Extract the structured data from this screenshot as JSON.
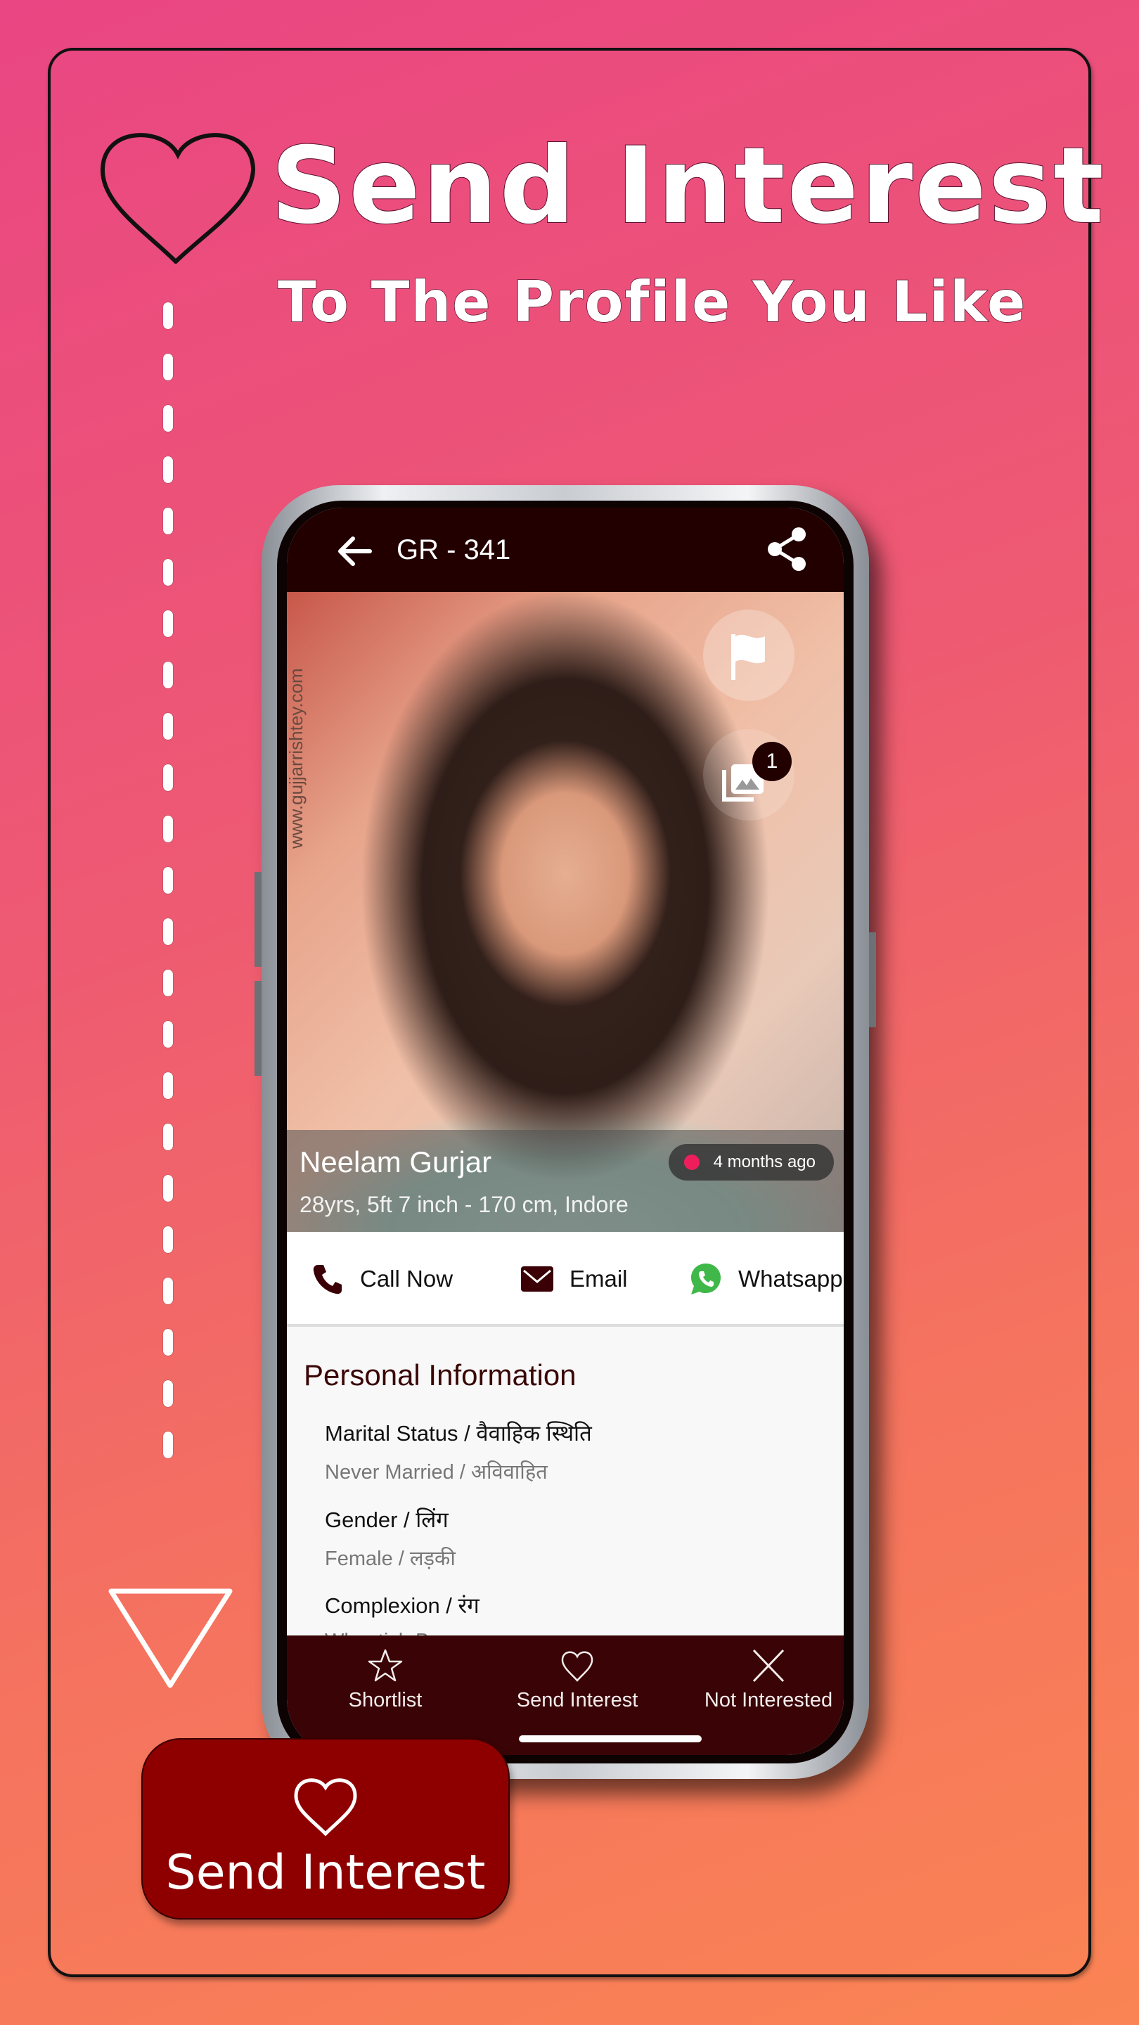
{
  "promo": {
    "headline": "Send Interest",
    "subheadline": "To The Profile You Like",
    "cta_label": "Send Interest"
  },
  "appbar": {
    "title": "GR - 341",
    "back_icon": "arrow-left-icon",
    "share_icon": "share-icon"
  },
  "profile": {
    "watermark": "www.gujjarrishtey.com",
    "name": "Neelam Gurjar",
    "details": "28yrs, 5ft 7 inch - 170 cm, Indore",
    "last_seen": "4 months ago",
    "photo_count": "1",
    "status_dot_color": "#ee1e5d"
  },
  "contact": {
    "call": "Call Now",
    "email": "Email",
    "whatsapp": "Whatsapp",
    "whatsapp_color": "#3fb849",
    "icon_color": "#3a0006"
  },
  "personal_info": {
    "title": "Personal Information",
    "fields": [
      {
        "label": "Marital Status / वैवाहिक स्थिति",
        "value": "Never Married / अविवाहित"
      },
      {
        "label": "Gender / लिंग",
        "value": "Female / लड़की"
      },
      {
        "label": "Complexion / रंग",
        "value": "Wheatish Brown"
      }
    ]
  },
  "bottom_nav": {
    "items": [
      {
        "label": "Shortlist",
        "icon": "star-icon"
      },
      {
        "label": "Send Interest",
        "icon": "heart-icon"
      },
      {
        "label": "Not Interested",
        "icon": "close-icon"
      }
    ]
  },
  "colors": {
    "appbar": "#230000",
    "bottom_nav": "#3a0305",
    "cta": "#8e0000",
    "section_title": "#3a0606"
  }
}
